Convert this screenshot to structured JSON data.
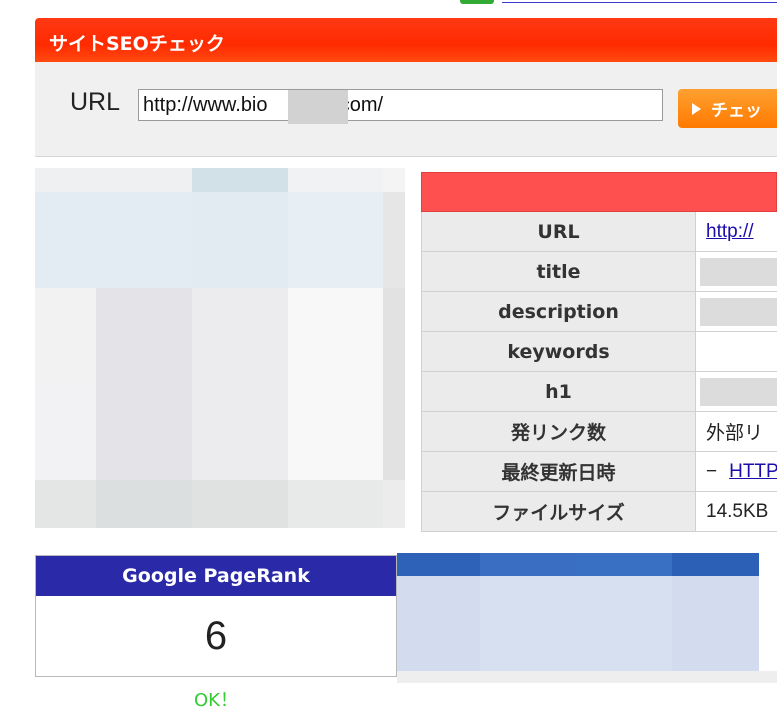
{
  "header": {
    "title": "サイトSEOチェック"
  },
  "url_form": {
    "label": "URL",
    "value": "http://www.bio          n.com/",
    "check_button": "チェッ"
  },
  "info_table": {
    "rows": [
      {
        "key": "URL",
        "value": "http://"
      },
      {
        "key": "title",
        "value": ""
      },
      {
        "key": "description",
        "value": ""
      },
      {
        "key": "keywords",
        "value": ""
      },
      {
        "key": "h1",
        "value": ""
      },
      {
        "key": "発リンク数",
        "value": "外部リ"
      },
      {
        "key": "最終更新日時",
        "value_prefix": "−",
        "value": "HTTP"
      },
      {
        "key": "ファイルサイズ",
        "value": "14.5KB"
      }
    ]
  },
  "pagerank": {
    "title": "Google PageRank",
    "value": "6",
    "status": "OK！"
  },
  "colors": {
    "header_red": "#ff2a00",
    "table_head_red": "#ff5050",
    "check_orange": "#ff8a10",
    "pagerank_blue": "#2a2aa8",
    "ok_green": "#33cc33"
  }
}
